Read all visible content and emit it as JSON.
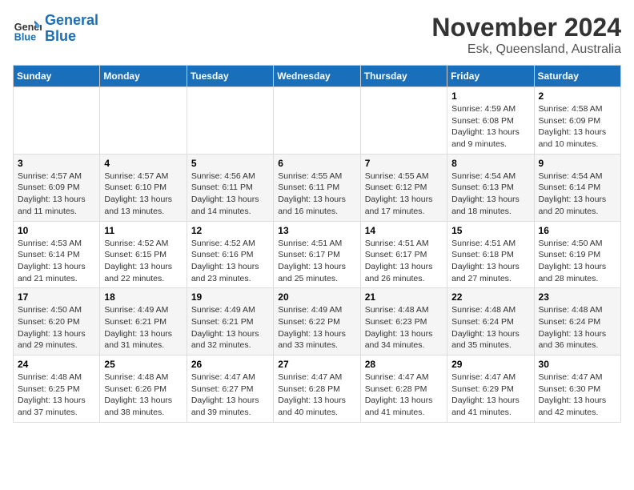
{
  "logo": {
    "text_general": "General",
    "text_blue": "Blue"
  },
  "header": {
    "month": "November 2024",
    "location": "Esk, Queensland, Australia"
  },
  "weekdays": [
    "Sunday",
    "Monday",
    "Tuesday",
    "Wednesday",
    "Thursday",
    "Friday",
    "Saturday"
  ],
  "weeks": [
    [
      {
        "day": "",
        "info": ""
      },
      {
        "day": "",
        "info": ""
      },
      {
        "day": "",
        "info": ""
      },
      {
        "day": "",
        "info": ""
      },
      {
        "day": "",
        "info": ""
      },
      {
        "day": "1",
        "info": "Sunrise: 4:59 AM\nSunset: 6:08 PM\nDaylight: 13 hours\nand 9 minutes."
      },
      {
        "day": "2",
        "info": "Sunrise: 4:58 AM\nSunset: 6:09 PM\nDaylight: 13 hours\nand 10 minutes."
      }
    ],
    [
      {
        "day": "3",
        "info": "Sunrise: 4:57 AM\nSunset: 6:09 PM\nDaylight: 13 hours\nand 11 minutes."
      },
      {
        "day": "4",
        "info": "Sunrise: 4:57 AM\nSunset: 6:10 PM\nDaylight: 13 hours\nand 13 minutes."
      },
      {
        "day": "5",
        "info": "Sunrise: 4:56 AM\nSunset: 6:11 PM\nDaylight: 13 hours\nand 14 minutes."
      },
      {
        "day": "6",
        "info": "Sunrise: 4:55 AM\nSunset: 6:11 PM\nDaylight: 13 hours\nand 16 minutes."
      },
      {
        "day": "7",
        "info": "Sunrise: 4:55 AM\nSunset: 6:12 PM\nDaylight: 13 hours\nand 17 minutes."
      },
      {
        "day": "8",
        "info": "Sunrise: 4:54 AM\nSunset: 6:13 PM\nDaylight: 13 hours\nand 18 minutes."
      },
      {
        "day": "9",
        "info": "Sunrise: 4:54 AM\nSunset: 6:14 PM\nDaylight: 13 hours\nand 20 minutes."
      }
    ],
    [
      {
        "day": "10",
        "info": "Sunrise: 4:53 AM\nSunset: 6:14 PM\nDaylight: 13 hours\nand 21 minutes."
      },
      {
        "day": "11",
        "info": "Sunrise: 4:52 AM\nSunset: 6:15 PM\nDaylight: 13 hours\nand 22 minutes."
      },
      {
        "day": "12",
        "info": "Sunrise: 4:52 AM\nSunset: 6:16 PM\nDaylight: 13 hours\nand 23 minutes."
      },
      {
        "day": "13",
        "info": "Sunrise: 4:51 AM\nSunset: 6:17 PM\nDaylight: 13 hours\nand 25 minutes."
      },
      {
        "day": "14",
        "info": "Sunrise: 4:51 AM\nSunset: 6:17 PM\nDaylight: 13 hours\nand 26 minutes."
      },
      {
        "day": "15",
        "info": "Sunrise: 4:51 AM\nSunset: 6:18 PM\nDaylight: 13 hours\nand 27 minutes."
      },
      {
        "day": "16",
        "info": "Sunrise: 4:50 AM\nSunset: 6:19 PM\nDaylight: 13 hours\nand 28 minutes."
      }
    ],
    [
      {
        "day": "17",
        "info": "Sunrise: 4:50 AM\nSunset: 6:20 PM\nDaylight: 13 hours\nand 29 minutes."
      },
      {
        "day": "18",
        "info": "Sunrise: 4:49 AM\nSunset: 6:21 PM\nDaylight: 13 hours\nand 31 minutes."
      },
      {
        "day": "19",
        "info": "Sunrise: 4:49 AM\nSunset: 6:21 PM\nDaylight: 13 hours\nand 32 minutes."
      },
      {
        "day": "20",
        "info": "Sunrise: 4:49 AM\nSunset: 6:22 PM\nDaylight: 13 hours\nand 33 minutes."
      },
      {
        "day": "21",
        "info": "Sunrise: 4:48 AM\nSunset: 6:23 PM\nDaylight: 13 hours\nand 34 minutes."
      },
      {
        "day": "22",
        "info": "Sunrise: 4:48 AM\nSunset: 6:24 PM\nDaylight: 13 hours\nand 35 minutes."
      },
      {
        "day": "23",
        "info": "Sunrise: 4:48 AM\nSunset: 6:24 PM\nDaylight: 13 hours\nand 36 minutes."
      }
    ],
    [
      {
        "day": "24",
        "info": "Sunrise: 4:48 AM\nSunset: 6:25 PM\nDaylight: 13 hours\nand 37 minutes."
      },
      {
        "day": "25",
        "info": "Sunrise: 4:48 AM\nSunset: 6:26 PM\nDaylight: 13 hours\nand 38 minutes."
      },
      {
        "day": "26",
        "info": "Sunrise: 4:47 AM\nSunset: 6:27 PM\nDaylight: 13 hours\nand 39 minutes."
      },
      {
        "day": "27",
        "info": "Sunrise: 4:47 AM\nSunset: 6:28 PM\nDaylight: 13 hours\nand 40 minutes."
      },
      {
        "day": "28",
        "info": "Sunrise: 4:47 AM\nSunset: 6:28 PM\nDaylight: 13 hours\nand 41 minutes."
      },
      {
        "day": "29",
        "info": "Sunrise: 4:47 AM\nSunset: 6:29 PM\nDaylight: 13 hours\nand 41 minutes."
      },
      {
        "day": "30",
        "info": "Sunrise: 4:47 AM\nSunset: 6:30 PM\nDaylight: 13 hours\nand 42 minutes."
      }
    ]
  ]
}
